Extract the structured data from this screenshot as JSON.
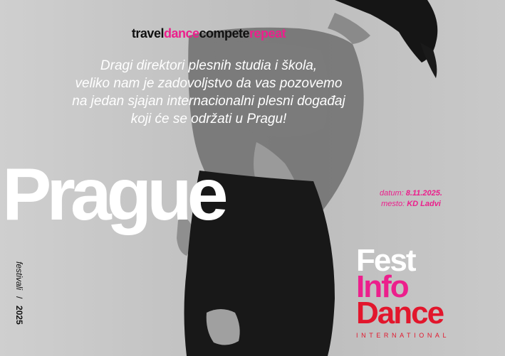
{
  "tagline": {
    "travel": "travel",
    "dance": "dance",
    "compete": "compete",
    "repeat": "repeat"
  },
  "intro": [
    "Dragi direktori plesnih studia i škola,",
    "veliko nam je zadovoljstvo da vas pozovemo",
    "na jedan sjajan internacionalni plesni događaj",
    "koji će se održati u Pragu!"
  ],
  "city": "Prague",
  "details": {
    "date_label": "datum:",
    "date_value": "8.11.2025.",
    "place_label": "mesto:",
    "place_value": "KD Ladvi"
  },
  "logo": {
    "line1": "Fest",
    "line2": "Info",
    "line3": "Dance",
    "subtitle": "INTERNATIONAL"
  },
  "vertical": {
    "category": "festivali",
    "separator": "/",
    "year": "2025"
  },
  "colors": {
    "accent_pink": "#ec1f8c",
    "accent_red": "#e2162c",
    "background": "#c6c6c6",
    "text_dark": "#111111"
  }
}
